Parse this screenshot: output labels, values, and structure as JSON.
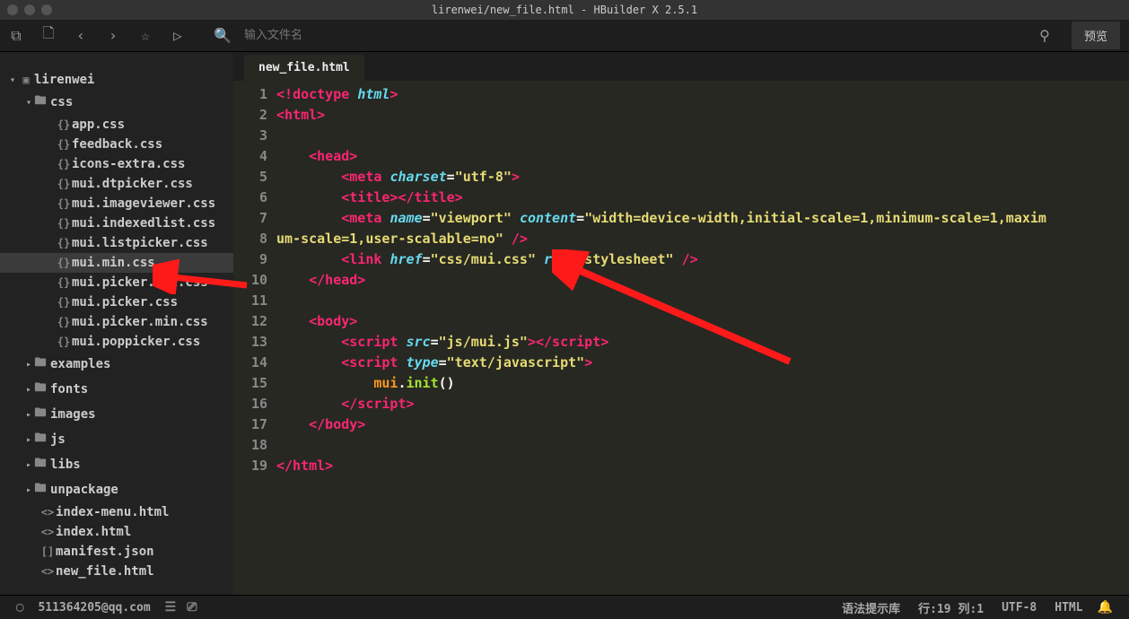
{
  "title": "lirenwei/new_file.html - HBuilder X 2.5.1",
  "toolbar": {
    "search_placeholder": "输入文件名",
    "preview": "预览"
  },
  "sidebar": {
    "root": "lirenwei",
    "css_folder": "css",
    "css_files": [
      "app.css",
      "feedback.css",
      "icons-extra.css",
      "mui.dtpicker.css",
      "mui.imageviewer.css",
      "mui.indexedlist.css",
      "mui.listpicker.css",
      "mui.min.css",
      "mui.picker.all.css",
      "mui.picker.css",
      "mui.picker.min.css",
      "mui.poppicker.css"
    ],
    "folders": [
      "examples",
      "fonts",
      "images",
      "js",
      "libs",
      "unpackage"
    ],
    "root_files": [
      {
        "name": "index-menu.html",
        "icon": "<>"
      },
      {
        "name": "index.html",
        "icon": "<>"
      },
      {
        "name": "manifest.json",
        "icon": "[]"
      },
      {
        "name": "new_file.html",
        "icon": "<>"
      }
    ]
  },
  "tab": "new_file.html",
  "lines": [
    "1",
    "2",
    "3",
    "4",
    "5",
    "6",
    "7",
    "8",
    "9",
    "10",
    "11",
    "12",
    "13",
    "14",
    "15",
    "16",
    "17",
    "18",
    "19"
  ],
  "status": {
    "user": "511364205@qq.com",
    "syntax": "语法提示库",
    "pos": "行:19 列:1",
    "encoding": "UTF-8",
    "lang": "HTML"
  }
}
